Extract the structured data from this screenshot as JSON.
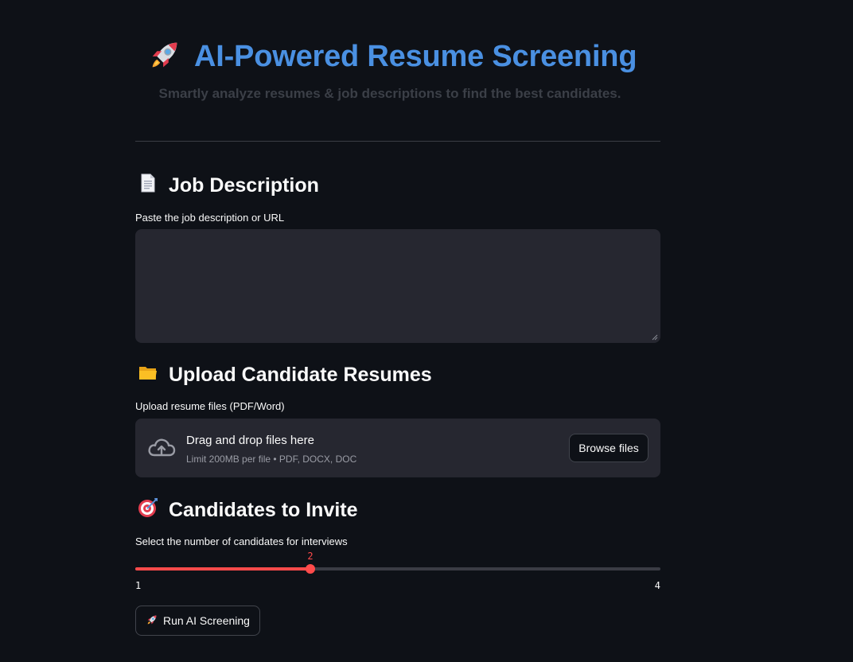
{
  "header": {
    "title": "AI-Powered Resume Screening",
    "title_icon": "rocket-icon",
    "subtitle": "Smartly analyze resumes & job descriptions to find the best candidates."
  },
  "job_description": {
    "heading": "Job Description",
    "heading_icon": "document-icon",
    "label": "Paste the job description or URL",
    "value": "",
    "placeholder": ""
  },
  "upload": {
    "heading": "Upload Candidate Resumes",
    "heading_icon": "folder-icon",
    "label": "Upload resume files (PDF/Word)",
    "drag_text": "Drag and drop files here",
    "limit_text": "Limit 200MB per file • PDF, DOCX, DOC",
    "browse_label": "Browse files",
    "upload_icon": "cloud-upload-icon"
  },
  "candidates": {
    "heading": "Candidates to Invite",
    "heading_icon": "target-icon",
    "label": "Select the number of candidates for interviews",
    "min": 1,
    "max": 4,
    "value": 2,
    "min_label": "1",
    "max_label": "4",
    "value_label": "2"
  },
  "run_button": {
    "label": "Run AI Screening",
    "icon": "rocket-icon"
  },
  "colors": {
    "background": "#0e1117",
    "title": "#4a90e2",
    "accent": "#ff4b4b",
    "input_bg": "#262730"
  }
}
